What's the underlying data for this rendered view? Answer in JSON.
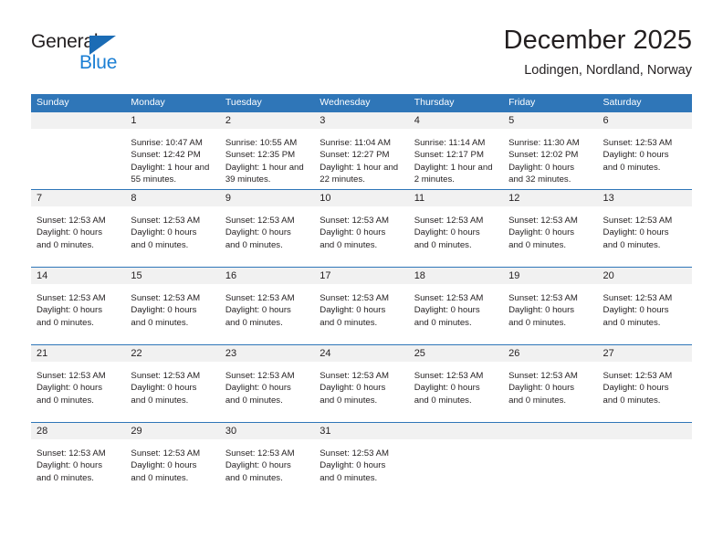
{
  "brand": {
    "name_top": "General",
    "name_bottom": "Blue",
    "triangle_color": "#1b6cb5",
    "blue_color": "#1b7fd4"
  },
  "header": {
    "title": "December 2025",
    "subtitle": "Lodingen, Nordland, Norway"
  },
  "theme": {
    "header_blue": "#2f76b8",
    "daynum_gray": "#f1f1f1",
    "text": "#231f20"
  },
  "weekday_headers": [
    "Sunday",
    "Monday",
    "Tuesday",
    "Wednesday",
    "Thursday",
    "Friday",
    "Saturday"
  ],
  "weeks": [
    [
      {
        "day": "",
        "lines": []
      },
      {
        "day": "1",
        "lines": [
          "Sunrise: 10:47 AM",
          "Sunset: 12:42 PM",
          "Daylight: 1 hour and 55 minutes."
        ]
      },
      {
        "day": "2",
        "lines": [
          "Sunrise: 10:55 AM",
          "Sunset: 12:35 PM",
          "Daylight: 1 hour and 39 minutes."
        ]
      },
      {
        "day": "3",
        "lines": [
          "Sunrise: 11:04 AM",
          "Sunset: 12:27 PM",
          "Daylight: 1 hour and 22 minutes."
        ]
      },
      {
        "day": "4",
        "lines": [
          "Sunrise: 11:14 AM",
          "Sunset: 12:17 PM",
          "Daylight: 1 hour and 2 minutes."
        ]
      },
      {
        "day": "5",
        "lines": [
          "Sunrise: 11:30 AM",
          "Sunset: 12:02 PM",
          "Daylight: 0 hours and 32 minutes."
        ]
      },
      {
        "day": "6",
        "lines": [
          "Sunset: 12:53 AM",
          "Daylight: 0 hours and 0 minutes."
        ]
      }
    ],
    [
      {
        "day": "7",
        "lines": [
          "Sunset: 12:53 AM",
          "Daylight: 0 hours and 0 minutes."
        ]
      },
      {
        "day": "8",
        "lines": [
          "Sunset: 12:53 AM",
          "Daylight: 0 hours and 0 minutes."
        ]
      },
      {
        "day": "9",
        "lines": [
          "Sunset: 12:53 AM",
          "Daylight: 0 hours and 0 minutes."
        ]
      },
      {
        "day": "10",
        "lines": [
          "Sunset: 12:53 AM",
          "Daylight: 0 hours and 0 minutes."
        ]
      },
      {
        "day": "11",
        "lines": [
          "Sunset: 12:53 AM",
          "Daylight: 0 hours and 0 minutes."
        ]
      },
      {
        "day": "12",
        "lines": [
          "Sunset: 12:53 AM",
          "Daylight: 0 hours and 0 minutes."
        ]
      },
      {
        "day": "13",
        "lines": [
          "Sunset: 12:53 AM",
          "Daylight: 0 hours and 0 minutes."
        ]
      }
    ],
    [
      {
        "day": "14",
        "lines": [
          "Sunset: 12:53 AM",
          "Daylight: 0 hours and 0 minutes."
        ]
      },
      {
        "day": "15",
        "lines": [
          "Sunset: 12:53 AM",
          "Daylight: 0 hours and 0 minutes."
        ]
      },
      {
        "day": "16",
        "lines": [
          "Sunset: 12:53 AM",
          "Daylight: 0 hours and 0 minutes."
        ]
      },
      {
        "day": "17",
        "lines": [
          "Sunset: 12:53 AM",
          "Daylight: 0 hours and 0 minutes."
        ]
      },
      {
        "day": "18",
        "lines": [
          "Sunset: 12:53 AM",
          "Daylight: 0 hours and 0 minutes."
        ]
      },
      {
        "day": "19",
        "lines": [
          "Sunset: 12:53 AM",
          "Daylight: 0 hours and 0 minutes."
        ]
      },
      {
        "day": "20",
        "lines": [
          "Sunset: 12:53 AM",
          "Daylight: 0 hours and 0 minutes."
        ]
      }
    ],
    [
      {
        "day": "21",
        "lines": [
          "Sunset: 12:53 AM",
          "Daylight: 0 hours and 0 minutes."
        ]
      },
      {
        "day": "22",
        "lines": [
          "Sunset: 12:53 AM",
          "Daylight: 0 hours and 0 minutes."
        ]
      },
      {
        "day": "23",
        "lines": [
          "Sunset: 12:53 AM",
          "Daylight: 0 hours and 0 minutes."
        ]
      },
      {
        "day": "24",
        "lines": [
          "Sunset: 12:53 AM",
          "Daylight: 0 hours and 0 minutes."
        ]
      },
      {
        "day": "25",
        "lines": [
          "Sunset: 12:53 AM",
          "Daylight: 0 hours and 0 minutes."
        ]
      },
      {
        "day": "26",
        "lines": [
          "Sunset: 12:53 AM",
          "Daylight: 0 hours and 0 minutes."
        ]
      },
      {
        "day": "27",
        "lines": [
          "Sunset: 12:53 AM",
          "Daylight: 0 hours and 0 minutes."
        ]
      }
    ],
    [
      {
        "day": "28",
        "lines": [
          "Sunset: 12:53 AM",
          "Daylight: 0 hours and 0 minutes."
        ]
      },
      {
        "day": "29",
        "lines": [
          "Sunset: 12:53 AM",
          "Daylight: 0 hours and 0 minutes."
        ]
      },
      {
        "day": "30",
        "lines": [
          "Sunset: 12:53 AM",
          "Daylight: 0 hours and 0 minutes."
        ]
      },
      {
        "day": "31",
        "lines": [
          "Sunset: 12:53 AM",
          "Daylight: 0 hours and 0 minutes."
        ]
      },
      {
        "day": "",
        "lines": []
      },
      {
        "day": "",
        "lines": []
      },
      {
        "day": "",
        "lines": []
      }
    ]
  ]
}
